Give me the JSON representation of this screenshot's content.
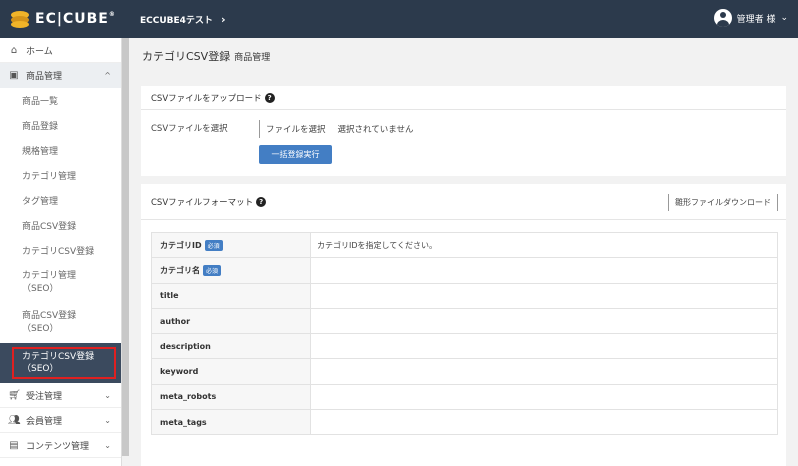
{
  "header": {
    "logo": "EC|CUBE",
    "logo_mark": "®",
    "shop_name": "ECCUBE4テスト",
    "shop_chevron": "›",
    "user_name": "管理者 様",
    "user_chevron": "⌄"
  },
  "sidebar": {
    "home": "ホーム",
    "product_mgmt": "商品管理",
    "chev_up": "^",
    "chev_down": "⌄",
    "sub_items": [
      "商品一覧",
      "商品登録",
      "規格管理",
      "カテゴリ管理",
      "タグ管理",
      "商品CSV登録",
      "カテゴリCSV登録"
    ],
    "sub_tall_1": [
      "カテゴリ管理",
      "（SEO）"
    ],
    "sub_tall_2": [
      "商品CSV登録",
      "（SEO）"
    ],
    "active": [
      "カテゴリCSV登録",
      "（SEO）"
    ],
    "order_mgmt": "受注管理",
    "member_mgmt": "会員管理",
    "content_mgmt": "コンテンツ管理"
  },
  "page": {
    "title": "カテゴリCSV登録",
    "subtitle": "商品管理"
  },
  "upload_card": {
    "heading": "CSVファイルをアップロード",
    "label": "CSVファイルを選択",
    "file_button": "ファイルを選択",
    "file_status": "選択されていません",
    "submit": "一括登録実行"
  },
  "format_card": {
    "heading": "CSVファイルフォーマット",
    "download": "雛形ファイルダウンロード",
    "required_badge": "必須",
    "rows": [
      {
        "key": "カテゴリID",
        "required": true,
        "value": "カテゴリIDを指定してください。"
      },
      {
        "key": "カテゴリ名",
        "required": true,
        "value": ""
      },
      {
        "key": "title",
        "required": false,
        "value": ""
      },
      {
        "key": "author",
        "required": false,
        "value": ""
      },
      {
        "key": "description",
        "required": false,
        "value": ""
      },
      {
        "key": "keyword",
        "required": false,
        "value": ""
      },
      {
        "key": "meta_robots",
        "required": false,
        "value": ""
      },
      {
        "key": "meta_tags",
        "required": false,
        "value": ""
      }
    ]
  }
}
